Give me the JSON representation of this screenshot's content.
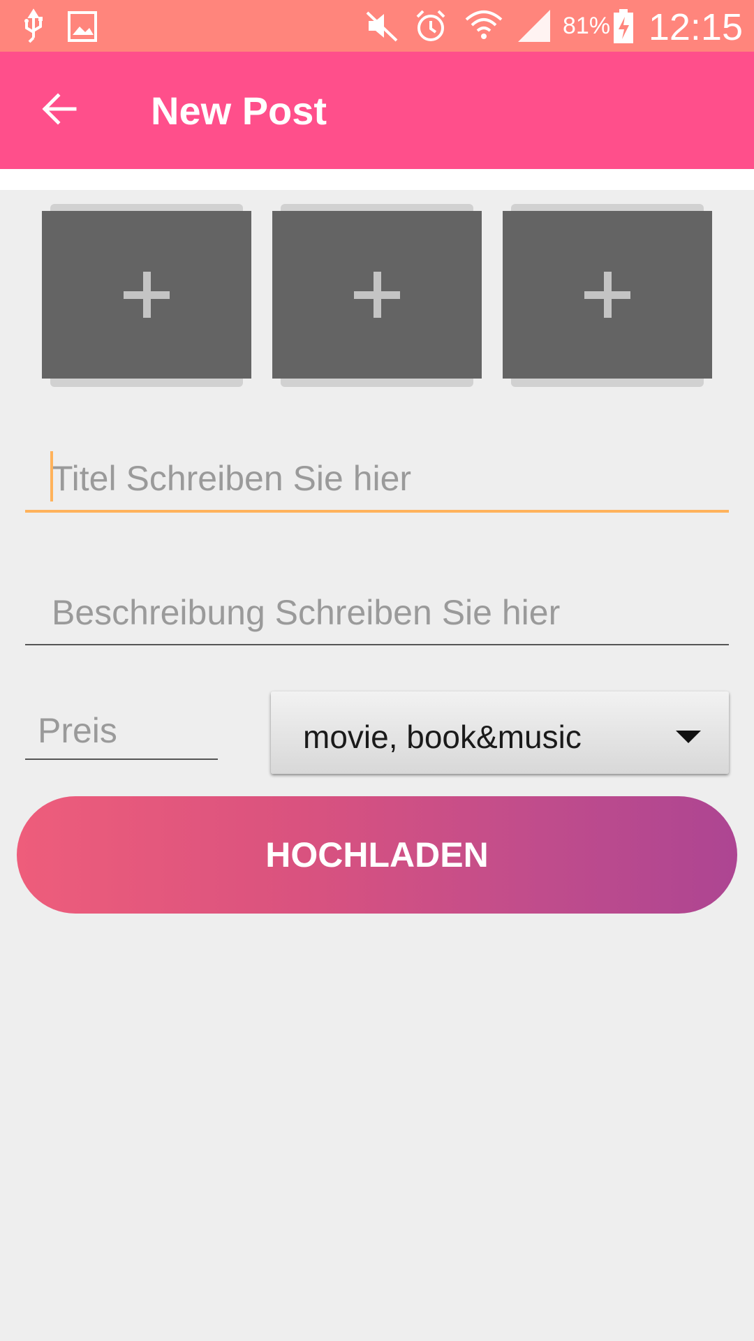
{
  "status_bar": {
    "battery_percent": "81%",
    "time": "12:15",
    "icons": [
      "usb-icon",
      "image-icon",
      "mute-icon",
      "alarm-icon",
      "wifi-icon",
      "signal-icon",
      "battery-charging-icon"
    ]
  },
  "app_bar": {
    "title": "New Post",
    "back_icon": "arrow-left-icon"
  },
  "photo_slots": [
    {
      "icon": "plus-icon"
    },
    {
      "icon": "plus-icon"
    },
    {
      "icon": "plus-icon"
    }
  ],
  "form": {
    "title_placeholder": "Titel Schreiben Sie hier",
    "description_placeholder": "Beschreibung Schreiben Sie hier",
    "price_placeholder": "Preis",
    "category_value": "movie, book&music",
    "upload_label": "HOCHLADEN"
  },
  "colors": {
    "status_bar": "#ff857c",
    "app_bar": "#ff4f8b",
    "focus_accent": "#ffb25b",
    "button_gradient_start": "#ee5d7b",
    "button_gradient_end": "#ad4592"
  }
}
